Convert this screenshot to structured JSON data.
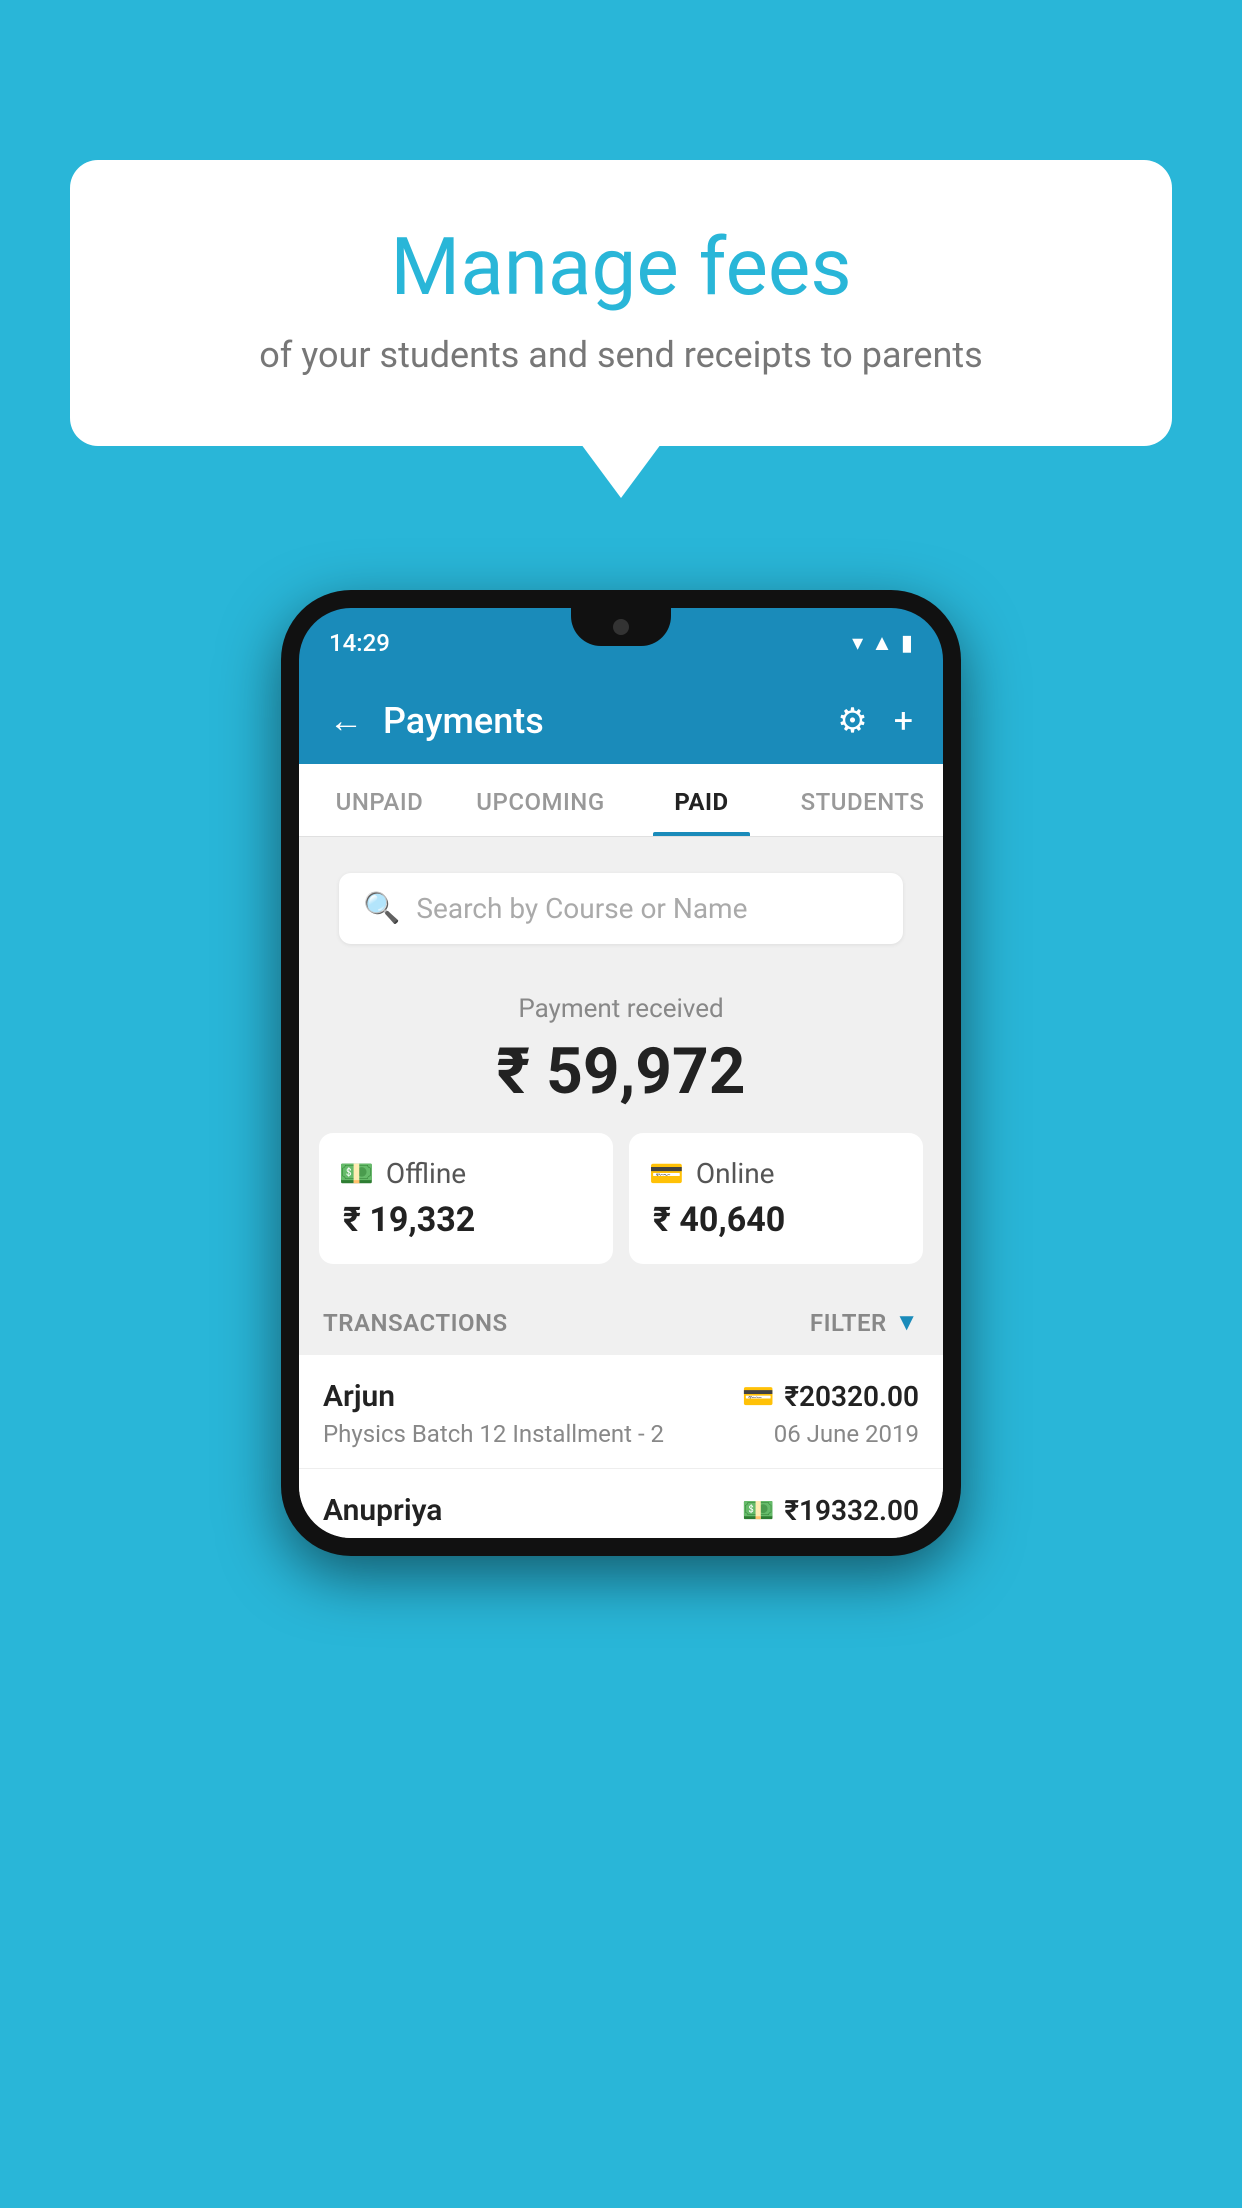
{
  "background": "#29b6d8",
  "bubble": {
    "title": "Manage fees",
    "subtitle": "of your students and send receipts to parents"
  },
  "status_bar": {
    "time": "14:29"
  },
  "header": {
    "title": "Payments",
    "back_label": "←",
    "settings_label": "⚙",
    "add_label": "+"
  },
  "tabs": [
    {
      "label": "UNPAID",
      "active": false
    },
    {
      "label": "UPCOMING",
      "active": false
    },
    {
      "label": "PAID",
      "active": true
    },
    {
      "label": "STUDENTS",
      "active": false
    }
  ],
  "search": {
    "placeholder": "Search by Course or Name"
  },
  "payment_summary": {
    "label": "Payment received",
    "total": "₹ 59,972",
    "offline_label": "Offline",
    "offline_amount": "₹ 19,332",
    "online_label": "Online",
    "online_amount": "₹ 40,640"
  },
  "transactions_section": {
    "label": "TRANSACTIONS",
    "filter_label": "FILTER"
  },
  "transactions": [
    {
      "name": "Arjun",
      "course": "Physics Batch 12 Installment - 2",
      "amount": "₹20320.00",
      "date": "06 June 2019",
      "payment_type": "card"
    },
    {
      "name": "Anupriya",
      "amount": "₹19332.00",
      "payment_type": "cash"
    }
  ]
}
